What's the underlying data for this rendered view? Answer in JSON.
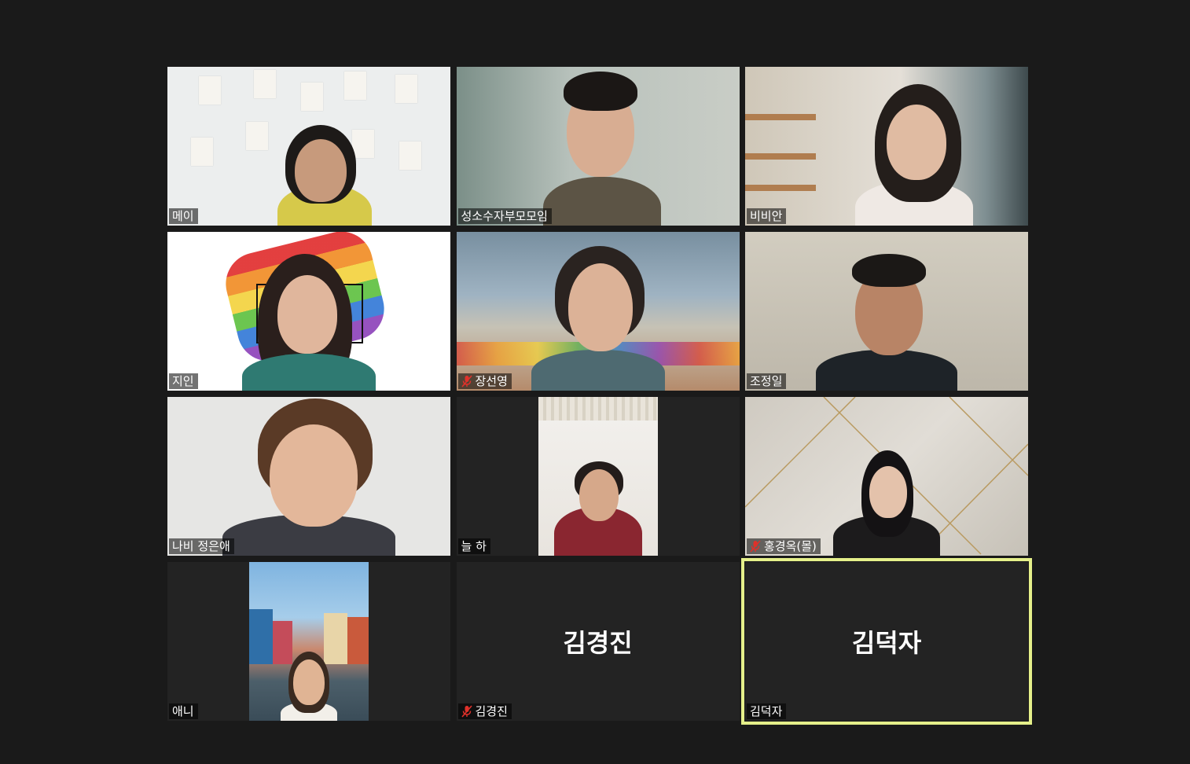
{
  "meeting": {
    "participants": [
      {
        "name": "메이",
        "muted": false,
        "video": true,
        "bg": "#eceeee",
        "shirt": "#d6c94a",
        "hair": "#1d1a18"
      },
      {
        "name": "성소수자부모모임",
        "muted": false,
        "video": true,
        "speaking": true,
        "bg": "#a9b3ae",
        "shirt": "#5c5445",
        "hair": "#1b1715"
      },
      {
        "name": "비비안",
        "muted": false,
        "video": true,
        "bg": "#d8d2c6",
        "shirt": "#efe9e4",
        "hair": "#241e1b"
      },
      {
        "name": "지인",
        "muted": false,
        "video": true,
        "bg": "#ffffff",
        "shirt": "#2f7a72",
        "hair": "#2a1f1c"
      },
      {
        "name": "장선영",
        "muted": true,
        "video": true,
        "bg": "#8fa6b6",
        "shirt": "#4e6a71",
        "hair": "#2a2320"
      },
      {
        "name": "조정일",
        "muted": false,
        "video": true,
        "bg": "#c9c4b8",
        "shirt": "#1e2328",
        "hair": "#1b1816"
      },
      {
        "name": "나비 정은애",
        "muted": false,
        "video": true,
        "bg": "#e6e6e4",
        "shirt": "#3b3c43",
        "hair": "#5a3a26"
      },
      {
        "name": "늘 하",
        "muted": false,
        "video": true,
        "narrow": true,
        "bg": "#f3f1ee",
        "shirt": "#8a2630",
        "hair": "#231c1a"
      },
      {
        "name": "홍경옥(몰)",
        "muted": true,
        "video": true,
        "bg": "#d6d2ca",
        "shirt": "#1c1b1c",
        "hair": "#141214"
      },
      {
        "name": "애니",
        "muted": false,
        "video": true,
        "narrow": true,
        "bg": "#8fc0e6",
        "shirt": "#f2efe9",
        "hair": "#3a2a20"
      },
      {
        "name": "김경진",
        "muted": true,
        "video": false
      },
      {
        "name": "김덕자",
        "muted": false,
        "video": false,
        "active": true
      }
    ]
  },
  "colors": {
    "background": "#1a1a1a",
    "tile": "#232323",
    "active_border": "#e5f08a",
    "speaking_bar": "#f4ec4f",
    "mute_red": "#e0312a"
  }
}
